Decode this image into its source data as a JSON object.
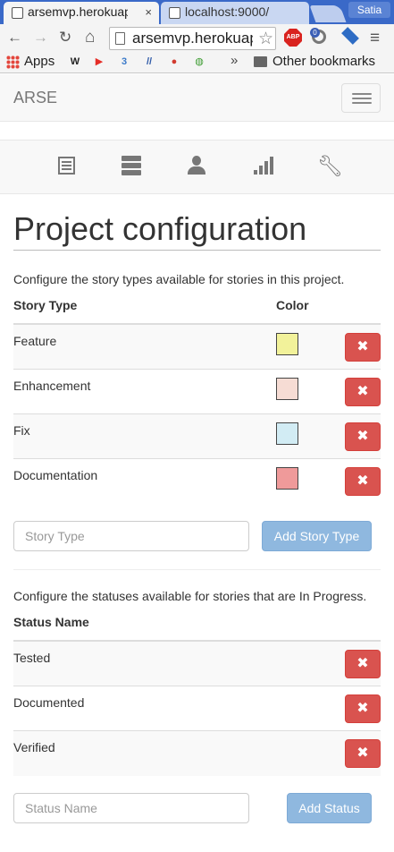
{
  "browser": {
    "tabs": [
      {
        "title": "arsemvp.herokuapp.com",
        "close": "×"
      },
      {
        "title": "localhost:9000/"
      }
    ],
    "profile_name": "Satia",
    "nav": {
      "back": "←",
      "forward": "→",
      "reload": "↻",
      "home": "⌂"
    },
    "url": "arsemvp.herokuapp.com",
    "star": "☆",
    "abp_label": "ABP",
    "ext_badge": "0",
    "menu_icon": "≡",
    "bookmarks": {
      "apps_label": "Apps",
      "items": [
        {
          "icon": "W",
          "color": "#222"
        },
        {
          "icon": "▶",
          "color": "#e52d27"
        },
        {
          "icon": "3",
          "color": "#3b7ac9"
        },
        {
          "icon": "//",
          "color": "#2f5aa8"
        },
        {
          "icon": "●",
          "color": "#d23b2f"
        },
        {
          "icon": "◍",
          "color": "#3a9a2e"
        }
      ],
      "chevron": "»",
      "other_label": "Other bookmarks"
    }
  },
  "app": {
    "brand": "ARSE",
    "nav_icons": [
      "list-icon",
      "server-icon",
      "user-icon",
      "signal-icon",
      "wrench-icon"
    ]
  },
  "main": {
    "title": "Project configuration",
    "story_types": {
      "description": "Configure the story types available for stories in this project.",
      "headers": {
        "name": "Story Type",
        "color": "Color"
      },
      "rows": [
        {
          "name": "Feature",
          "color": "#f2f29a"
        },
        {
          "name": "Enhancement",
          "color": "#f6dcd4"
        },
        {
          "name": "Fix",
          "color": "#d2ecf4"
        },
        {
          "name": "Documentation",
          "color": "#ef9a9a"
        }
      ],
      "delete_label": "✖",
      "input_placeholder": "Story Type",
      "add_label": "Add Story Type"
    },
    "statuses": {
      "description": "Configure the statuses available for stories that are In Progress.",
      "headers": {
        "name": "Status Name"
      },
      "rows": [
        {
          "name": "Tested"
        },
        {
          "name": "Documented"
        },
        {
          "name": "Verified"
        }
      ],
      "delete_label": "✖",
      "input_placeholder": "Status Name",
      "add_label": "Add Status"
    }
  }
}
